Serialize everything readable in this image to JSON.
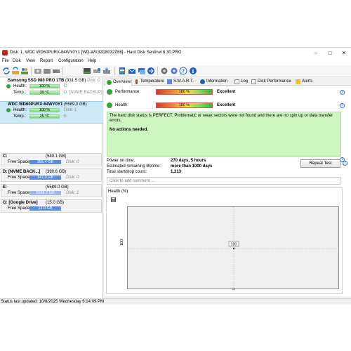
{
  "window": {
    "title": "Disk: 1, WDC WD60PURX-64WY0Y1 [WD-WX32D8032Z88]  -  Hard Disk Sentinel 6.30 PRO"
  },
  "menu": [
    "File",
    "Disk",
    "View",
    "Report",
    "Configuration",
    "Help"
  ],
  "toolbar_icons": [
    "refresh-icon",
    "refresh-all-icon",
    "users-icon",
    "disk-icon",
    "disk-info-icon",
    "drive-icon",
    "drive-remove-icon",
    "disk-test-icon",
    "report-icon",
    "email-icon",
    "message-icon",
    "send-icon",
    "settings-icon",
    "gear-icon",
    "help-icon",
    "info-icon"
  ],
  "disks": [
    {
      "name": "Samsung SSD 980 PRO 1TB",
      "size": "(931.5 GB)",
      "disk_no": "Disk: 0",
      "health_label": "Health:",
      "health": "100 %",
      "health_pct": 100,
      "health_extra": "C:",
      "temp_label": "Temp.:",
      "temp": "39 °C",
      "temp_extra": "D: [NVME BACKUP]"
    },
    {
      "name": "WDC WD60PURX-64WY0Y1",
      "size": "(5589.0 GB)",
      "disk_no": "Disk: 1",
      "health_label": "Health:",
      "health": "100 %",
      "health_pct": 100,
      "health_extra": "",
      "temp_label": "Temp.:",
      "temp": "25 °C",
      "temp_extra": "E:"
    }
  ],
  "drives": [
    {
      "letter": "C:",
      "size": "(540.1 GB)",
      "free_label": "Free Space",
      "free": "365.4 GB",
      "disk": "Disk: 0"
    },
    {
      "letter": "D: [NVME BACK...]",
      "size": "(390.6 GB)",
      "free_label": "Free Space",
      "free": "147.0 GB",
      "disk": "Disk: 0"
    },
    {
      "letter": "E:",
      "size": "(5589.0 GB)",
      "free_label": "Free Space",
      "free": "5568.7 GB",
      "disk": "Disk: 1"
    },
    {
      "letter": "G: [Google Drive]",
      "size": "(15.0 GB)",
      "free_label": "Free Space",
      "free": "12.0 GB",
      "disk": ""
    }
  ],
  "tabs": [
    "Overview",
    "Temperature",
    "S.M.A.R.T.",
    "Information",
    "Log",
    "Disk Performance",
    "Alerts"
  ],
  "overview": {
    "performance_label": "Performance:",
    "performance_value": "100 %",
    "performance_pct": 100,
    "performance_text": "Excellent",
    "health_label": "Health:",
    "health_value": "100 %",
    "health_pct": 100,
    "health_text": "Excellent",
    "status_msg": "The hard disk status is PERFECT. Problematic or weak sectors were not found and there are no spin up or data transfer errors.",
    "actions_msg": "No actions needed.",
    "power_on_label": "Power on time:",
    "power_on_value": "270 days, 5 hours",
    "remaining_label": "Estimated remaining lifetime:",
    "remaining_value": "more than 1000 days",
    "startstop_label": "Total start/stop count:",
    "startstop_value": "1,213",
    "repeat_test": "Repeat Test",
    "comment_placeholder": "Click to add comment ..."
  },
  "health_chart": {
    "tab": "Health (%)",
    "chart_data": {
      "type": "line",
      "x": [
        "10/8/2025"
      ],
      "series": [
        {
          "values": [
            100
          ]
        }
      ],
      "yticks": [
        "100"
      ],
      "point_label": "100"
    }
  },
  "statusbar": "Status last updated: 10/8/2025 Wednesday 6:14:09 PM",
  "colors": {
    "health_green": "#72d872",
    "free_blue": "#5b8ed8",
    "status_bg": "#ccf5c0",
    "selected_disk": "#cde8f7"
  }
}
